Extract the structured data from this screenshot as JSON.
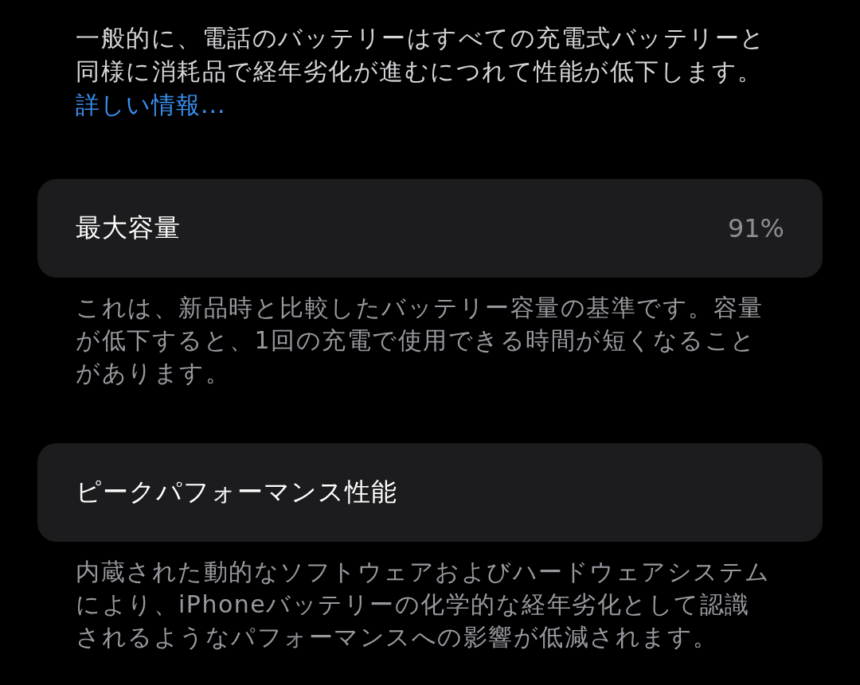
{
  "intro": {
    "lines": [
      "一般的に、電話のバッテリーはすべての充電式バッテリーと",
      "同様に消耗品で経年劣化が進むにつれて性能が低下します。"
    ],
    "link": "詳しい情報..."
  },
  "sections": [
    {
      "label": "最大容量",
      "value": "91%",
      "footer": [
        "これは、新品時と比較したバッテリー容量の基準です。容量",
        "が低下すると、1回の充電で使用できる時間が短くなること",
        "があります。"
      ]
    },
    {
      "label": "ピークパフォーマンス性能",
      "footer": [
        "内蔵された動的なソフトウェアおよびハードウェアシステム",
        "により、iPhoneバッテリーの化学的な経年劣化として認識",
        "されるようなパフォーマンスへの影響が低減されます。"
      ]
    }
  ]
}
